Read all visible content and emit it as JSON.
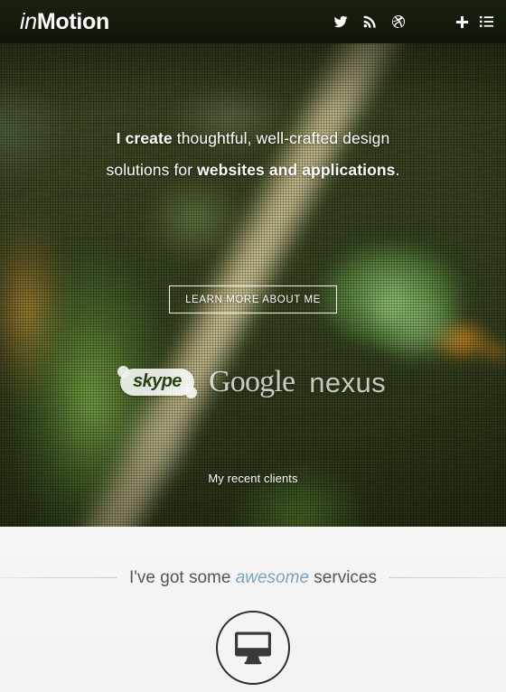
{
  "header": {
    "logo_in": "in",
    "logo_motion": "Motion",
    "social": [
      {
        "name": "twitter-icon",
        "label": "Twitter"
      },
      {
        "name": "rss-icon",
        "label": "RSS"
      },
      {
        "name": "dribbble-icon",
        "label": "Dribbble"
      }
    ],
    "plus_label": "+",
    "menu_label": "Menu",
    "background_color": "#161c0e"
  },
  "hero": {
    "headline_line1_bold": "I create",
    "headline_line1_rest": " thoughtful, well-crafted design",
    "headline_line2_pre": "solutions for ",
    "headline_line2_bold": "websites and applications",
    "headline_line2_post": ".",
    "cta_label": "LEARN MORE ABOUT ME",
    "clients": [
      {
        "name": "skype",
        "label": "skype"
      },
      {
        "name": "google",
        "label": "Google"
      },
      {
        "name": "nexus",
        "label": "nexus"
      }
    ],
    "clients_caption": "My recent clients",
    "text_color": "#ffffff"
  },
  "services": {
    "title_pre": "I've got some ",
    "title_em": "awesome",
    "title_post": " services",
    "accent_color": "#7ba3bc",
    "icon": {
      "name": "monitor-icon",
      "label": "Desktop"
    },
    "background_color": "#f4f4f4"
  }
}
